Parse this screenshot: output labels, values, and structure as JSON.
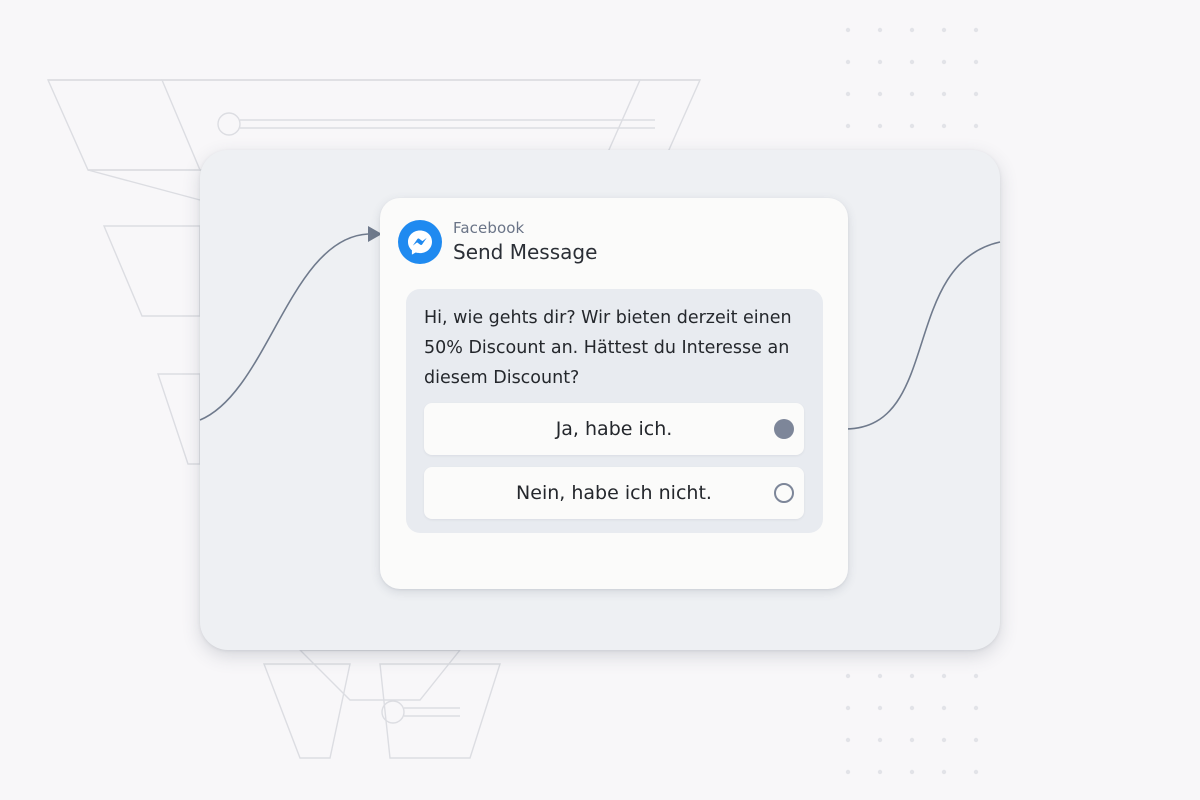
{
  "node": {
    "platform": "Facebook",
    "title": "Send Message",
    "icon": "messenger-icon",
    "message": "Hi, wie gehts dir? Wir bieten derzeit einen 50% Discount an. Hättest du Interesse an diesem Discount?",
    "replies": [
      {
        "label": "Ja, habe ich.",
        "connected": true
      },
      {
        "label": "Nein, habe ich nicht.",
        "connected": false
      }
    ]
  },
  "colors": {
    "accent": "#1f8af0",
    "connector": "#6f7a8c",
    "canvas": "#eef0f3",
    "card": "#fbfbfa",
    "message_bg": "#e8ebf0"
  }
}
